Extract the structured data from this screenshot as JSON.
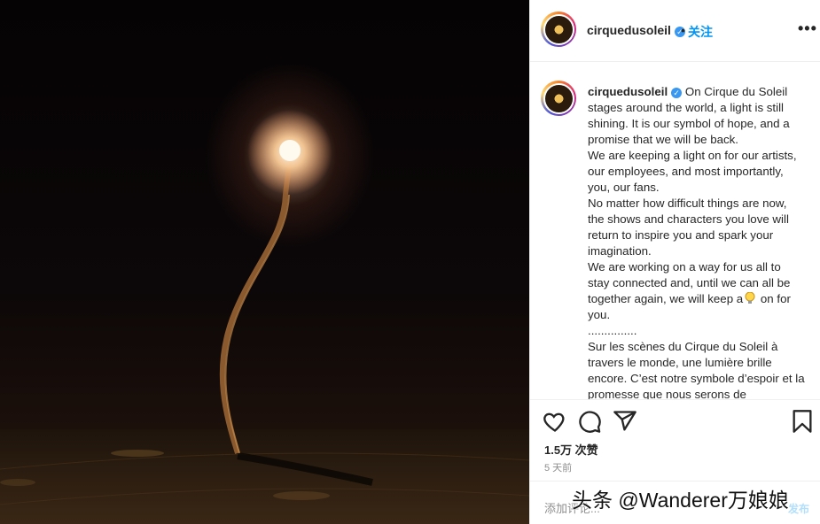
{
  "post": {
    "username": "cirquedusoleil",
    "follow_label": "关注",
    "separator": "•",
    "more_label": "•••",
    "caption_lines": [
      "On Cirque du Soleil stages around the world, a light is still shining. It is our symbol of hope, and a promise that we will be back.",
      "We are keeping a light on for our artists, our employees, and most importantly, you, our fans.",
      "No matter how difficult things are now, the shows and characters you love will return to inspire you and spark your imagination.",
      "We are working on a way for us all to stay connected and, until we can all be together again, we will keep a",
      "on for you.",
      "...............",
      "Sur les scènes du Cirque du Soleil à travers le monde, une lumière brille encore. C’est notre symbole d’espoir et la promesse que nous serons de"
    ],
    "likes": "1.5万 次赞",
    "time_ago": "5 天前",
    "comment_placeholder": "添加评论...",
    "post_button": "发布"
  },
  "watermark": "头条 @Wanderer万娘娘",
  "colors": {
    "accent": "#0095f6",
    "verified": "#3897f0",
    "muted": "#8e8e8e"
  },
  "icons": [
    "heart-icon",
    "comment-icon",
    "share-icon",
    "bookmark-icon",
    "verified-icon",
    "lightbulb-icon"
  ]
}
